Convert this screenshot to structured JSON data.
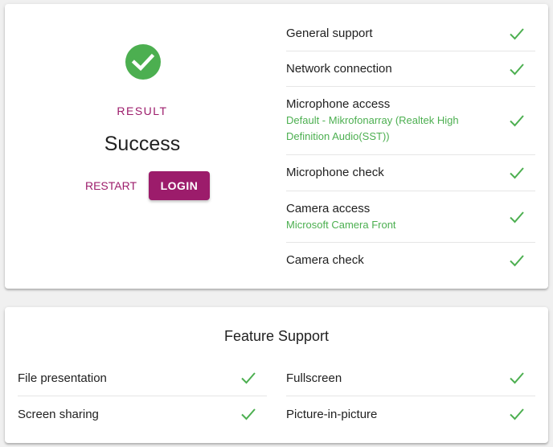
{
  "colors": {
    "accent": "#9c1c6b",
    "success": "#4caf50"
  },
  "result": {
    "icon": "check-circle-icon",
    "label": "RESULT",
    "status": "Success",
    "restart_label": "RESTART",
    "login_label": "LOGIN"
  },
  "checks": [
    {
      "name": "General support",
      "detail": "",
      "status": "ok"
    },
    {
      "name": "Network connection",
      "detail": "",
      "status": "ok"
    },
    {
      "name": "Microphone access",
      "detail": "Default - Mikrofonarray (Realtek High Definition Audio(SST))",
      "status": "ok"
    },
    {
      "name": "Microphone check",
      "detail": "",
      "status": "ok"
    },
    {
      "name": "Camera access",
      "detail": "Microsoft Camera Front",
      "status": "ok"
    },
    {
      "name": "Camera check",
      "detail": "",
      "status": "ok"
    }
  ],
  "feature_support": {
    "title": "Feature Support",
    "left": [
      {
        "name": "File presentation",
        "status": "ok"
      },
      {
        "name": "Screen sharing",
        "status": "ok"
      }
    ],
    "right": [
      {
        "name": "Fullscreen",
        "status": "ok"
      },
      {
        "name": "Picture-in-picture",
        "status": "ok"
      }
    ]
  }
}
